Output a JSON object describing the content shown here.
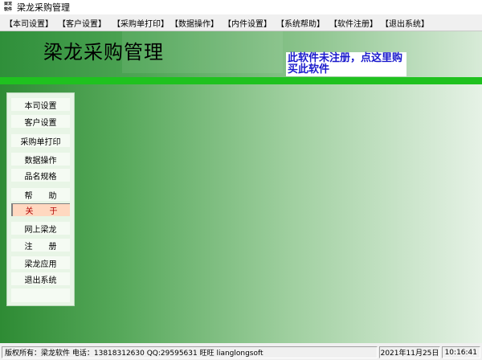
{
  "window": {
    "title": "梁龙采购管理",
    "icon_text": "梁龙软件"
  },
  "menu": [
    "【本司设置】",
    "【客户设置】",
    "【采购单打印】",
    "【数据操作】",
    "【内件设置】",
    "【系统帮助】",
    "【软件注册】",
    "【退出系统】"
  ],
  "banner": {
    "title": "梁龙采购管理",
    "notice": "此软件未注册，点这里购买此软件"
  },
  "sidebar": [
    {
      "label": "本司设置",
      "active": false
    },
    {
      "label": "客户设置",
      "active": false
    },
    {
      "label": "采购单打印",
      "active": false
    },
    {
      "label": "数据操作",
      "active": false
    },
    {
      "label": "品名规格",
      "active": false
    },
    {
      "label": "帮　　助",
      "active": false
    },
    {
      "label": "关　　于",
      "active": true
    },
    {
      "label": "网上梁龙",
      "active": false
    },
    {
      "label": "注　　册",
      "active": false
    },
    {
      "label": "梁龙应用",
      "active": false
    },
    {
      "label": "退出系统",
      "active": false
    }
  ],
  "status": {
    "info": "版权所有：梁龙软件 电话：13818312630 QQ:29595631 旺旺 lianglongsoft",
    "date": "2021年11月25日",
    "time": "10:16:41"
  },
  "colors": {
    "accent_green": "#1fc21f",
    "notice_text": "#1a1acc",
    "active_item_bg": "#ffd8c0"
  }
}
